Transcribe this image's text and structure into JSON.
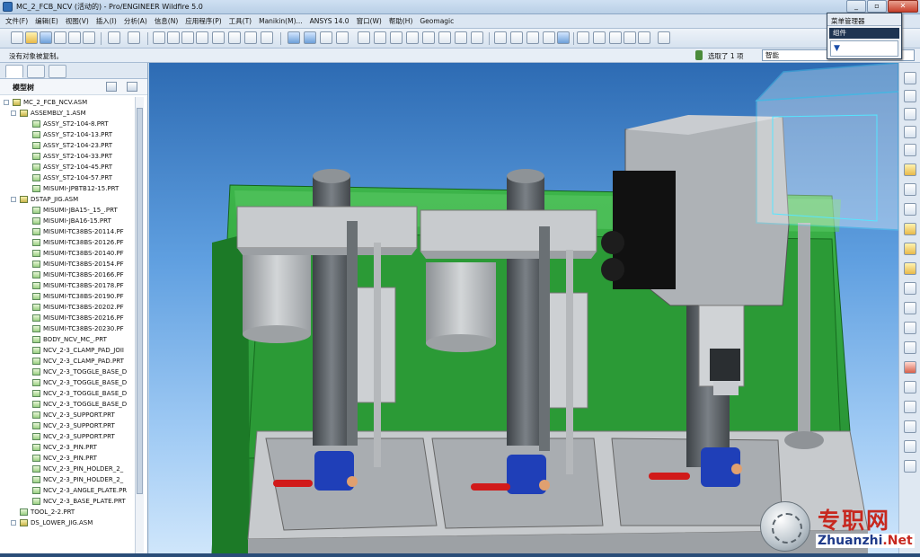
{
  "window": {
    "title": "MC_2_FCB_NCV (活动的) - Pro/ENGINEER Wildfire 5.0",
    "buttons": [
      "_",
      "▫",
      "✕"
    ]
  },
  "menu": [
    "文件(F)",
    "编辑(E)",
    "视图(V)",
    "插入(I)",
    "分析(A)",
    "信息(N)",
    "应用程序(P)",
    "工具(T)",
    "Manikin(M)...",
    "ANSYS 14.0",
    "窗口(W)",
    "帮助(H)",
    "Geomagic"
  ],
  "status": {
    "message": "没有对象被复制。",
    "selection": "选取了 1 项",
    "filter": "智能"
  },
  "popup": {
    "title": "菜单管理器",
    "item": "组件",
    "field": "▼"
  },
  "model_tree": {
    "title": "模型树",
    "rows": [
      {
        "label": "MC_2_FCB_NCV.ASM",
        "level": 0,
        "type": "asm"
      },
      {
        "label": "ASSEMBLY_1.ASM",
        "level": 1,
        "type": "asm"
      },
      {
        "label": "ASSY_ST2-104-8.PRT",
        "level": 2,
        "type": "prt"
      },
      {
        "label": "ASSY_ST2-104-13.PRT",
        "level": 2,
        "type": "prt"
      },
      {
        "label": "ASSY_ST2-104-23.PRT",
        "level": 2,
        "type": "prt"
      },
      {
        "label": "ASSY_ST2-104-33.PRT",
        "level": 2,
        "type": "prt"
      },
      {
        "label": "ASSY_ST2-104-45.PRT",
        "level": 2,
        "type": "prt"
      },
      {
        "label": "ASSY_ST2-104-57.PRT",
        "level": 2,
        "type": "prt"
      },
      {
        "label": "MISUMI-JPBTB12-15.PRT",
        "level": 2,
        "type": "prt"
      },
      {
        "label": "DSTAP_JIG.ASM",
        "level": 1,
        "type": "asm"
      },
      {
        "label": "MISUMI-JBA15-_15_.PRT",
        "level": 2,
        "type": "prt"
      },
      {
        "label": "MISUMI-JBA16-15.PRT",
        "level": 2,
        "type": "prt"
      },
      {
        "label": "MISUMI-TC38BS-20114.PF",
        "level": 2,
        "type": "prt"
      },
      {
        "label": "MISUMI-TC38BS-20126.PF",
        "level": 2,
        "type": "prt"
      },
      {
        "label": "MISUMI-TC38BS-20140.PF",
        "level": 2,
        "type": "prt"
      },
      {
        "label": "MISUMI-TC38BS-20154.PF",
        "level": 2,
        "type": "prt"
      },
      {
        "label": "MISUMI-TC38BS-20166.PF",
        "level": 2,
        "type": "prt"
      },
      {
        "label": "MISUMI-TC38BS-20178.PF",
        "level": 2,
        "type": "prt"
      },
      {
        "label": "MISUMI-TC38BS-20190.PF",
        "level": 2,
        "type": "prt"
      },
      {
        "label": "MISUMI-TC38BS-20202.PF",
        "level": 2,
        "type": "prt"
      },
      {
        "label": "MISUMI-TC38BS-20216.PF",
        "level": 2,
        "type": "prt"
      },
      {
        "label": "MISUMI-TC38BS-20230.PF",
        "level": 2,
        "type": "prt"
      },
      {
        "label": "BODY_NCV_MC_.PRT",
        "level": 2,
        "type": "prt"
      },
      {
        "label": "NCV_2-3_CLAMP_PAD_JOII",
        "level": 2,
        "type": "prt"
      },
      {
        "label": "NCV_2-3_CLAMP_PAD.PRT",
        "level": 2,
        "type": "prt"
      },
      {
        "label": "NCV_2-3_TOGGLE_BASE_D",
        "level": 2,
        "type": "prt"
      },
      {
        "label": "NCV_2-3_TOGGLE_BASE_D",
        "level": 2,
        "type": "prt"
      },
      {
        "label": "NCV_2-3_TOGGLE_BASE_D",
        "level": 2,
        "type": "prt"
      },
      {
        "label": "NCV_2-3_TOGGLE_BASE_D",
        "level": 2,
        "type": "prt"
      },
      {
        "label": "NCV_2-3_SUPPORT.PRT",
        "level": 2,
        "type": "prt"
      },
      {
        "label": "NCV_2-3_SUPPORT.PRT",
        "level": 2,
        "type": "prt"
      },
      {
        "label": "NCV_2-3_SUPPORT.PRT",
        "level": 2,
        "type": "prt"
      },
      {
        "label": "NCV_2-3_PIN.PRT",
        "level": 2,
        "type": "prt"
      },
      {
        "label": "NCV_2-3_PIN.PRT",
        "level": 2,
        "type": "prt"
      },
      {
        "label": "NCV_2-3_PIN_HOLDER_2_",
        "level": 2,
        "type": "prt"
      },
      {
        "label": "NCV_2-3_PIN_HOLDER_2_",
        "level": 2,
        "type": "prt"
      },
      {
        "label": "NCV_2-3_ANGLE_PLATE.PR",
        "level": 2,
        "type": "prt"
      },
      {
        "label": "NCV_2-3_BASE_PLATE.PRT",
        "level": 2,
        "type": "prt"
      },
      {
        "label": "TOOL_2-2.PRT",
        "level": 1,
        "type": "prt"
      },
      {
        "label": "DS_LOWER_JIG.ASM",
        "level": 1,
        "type": "asm"
      }
    ]
  },
  "watermark": {
    "cn": "专职网",
    "url_a": "Zhuanzhi",
    "url_b": ".Net"
  },
  "colors": {
    "frame_green": "#2f9f3a",
    "steel": "#b5b8bb",
    "accent_blue": "#1f3fb8",
    "handle_red": "#d11a1a"
  }
}
